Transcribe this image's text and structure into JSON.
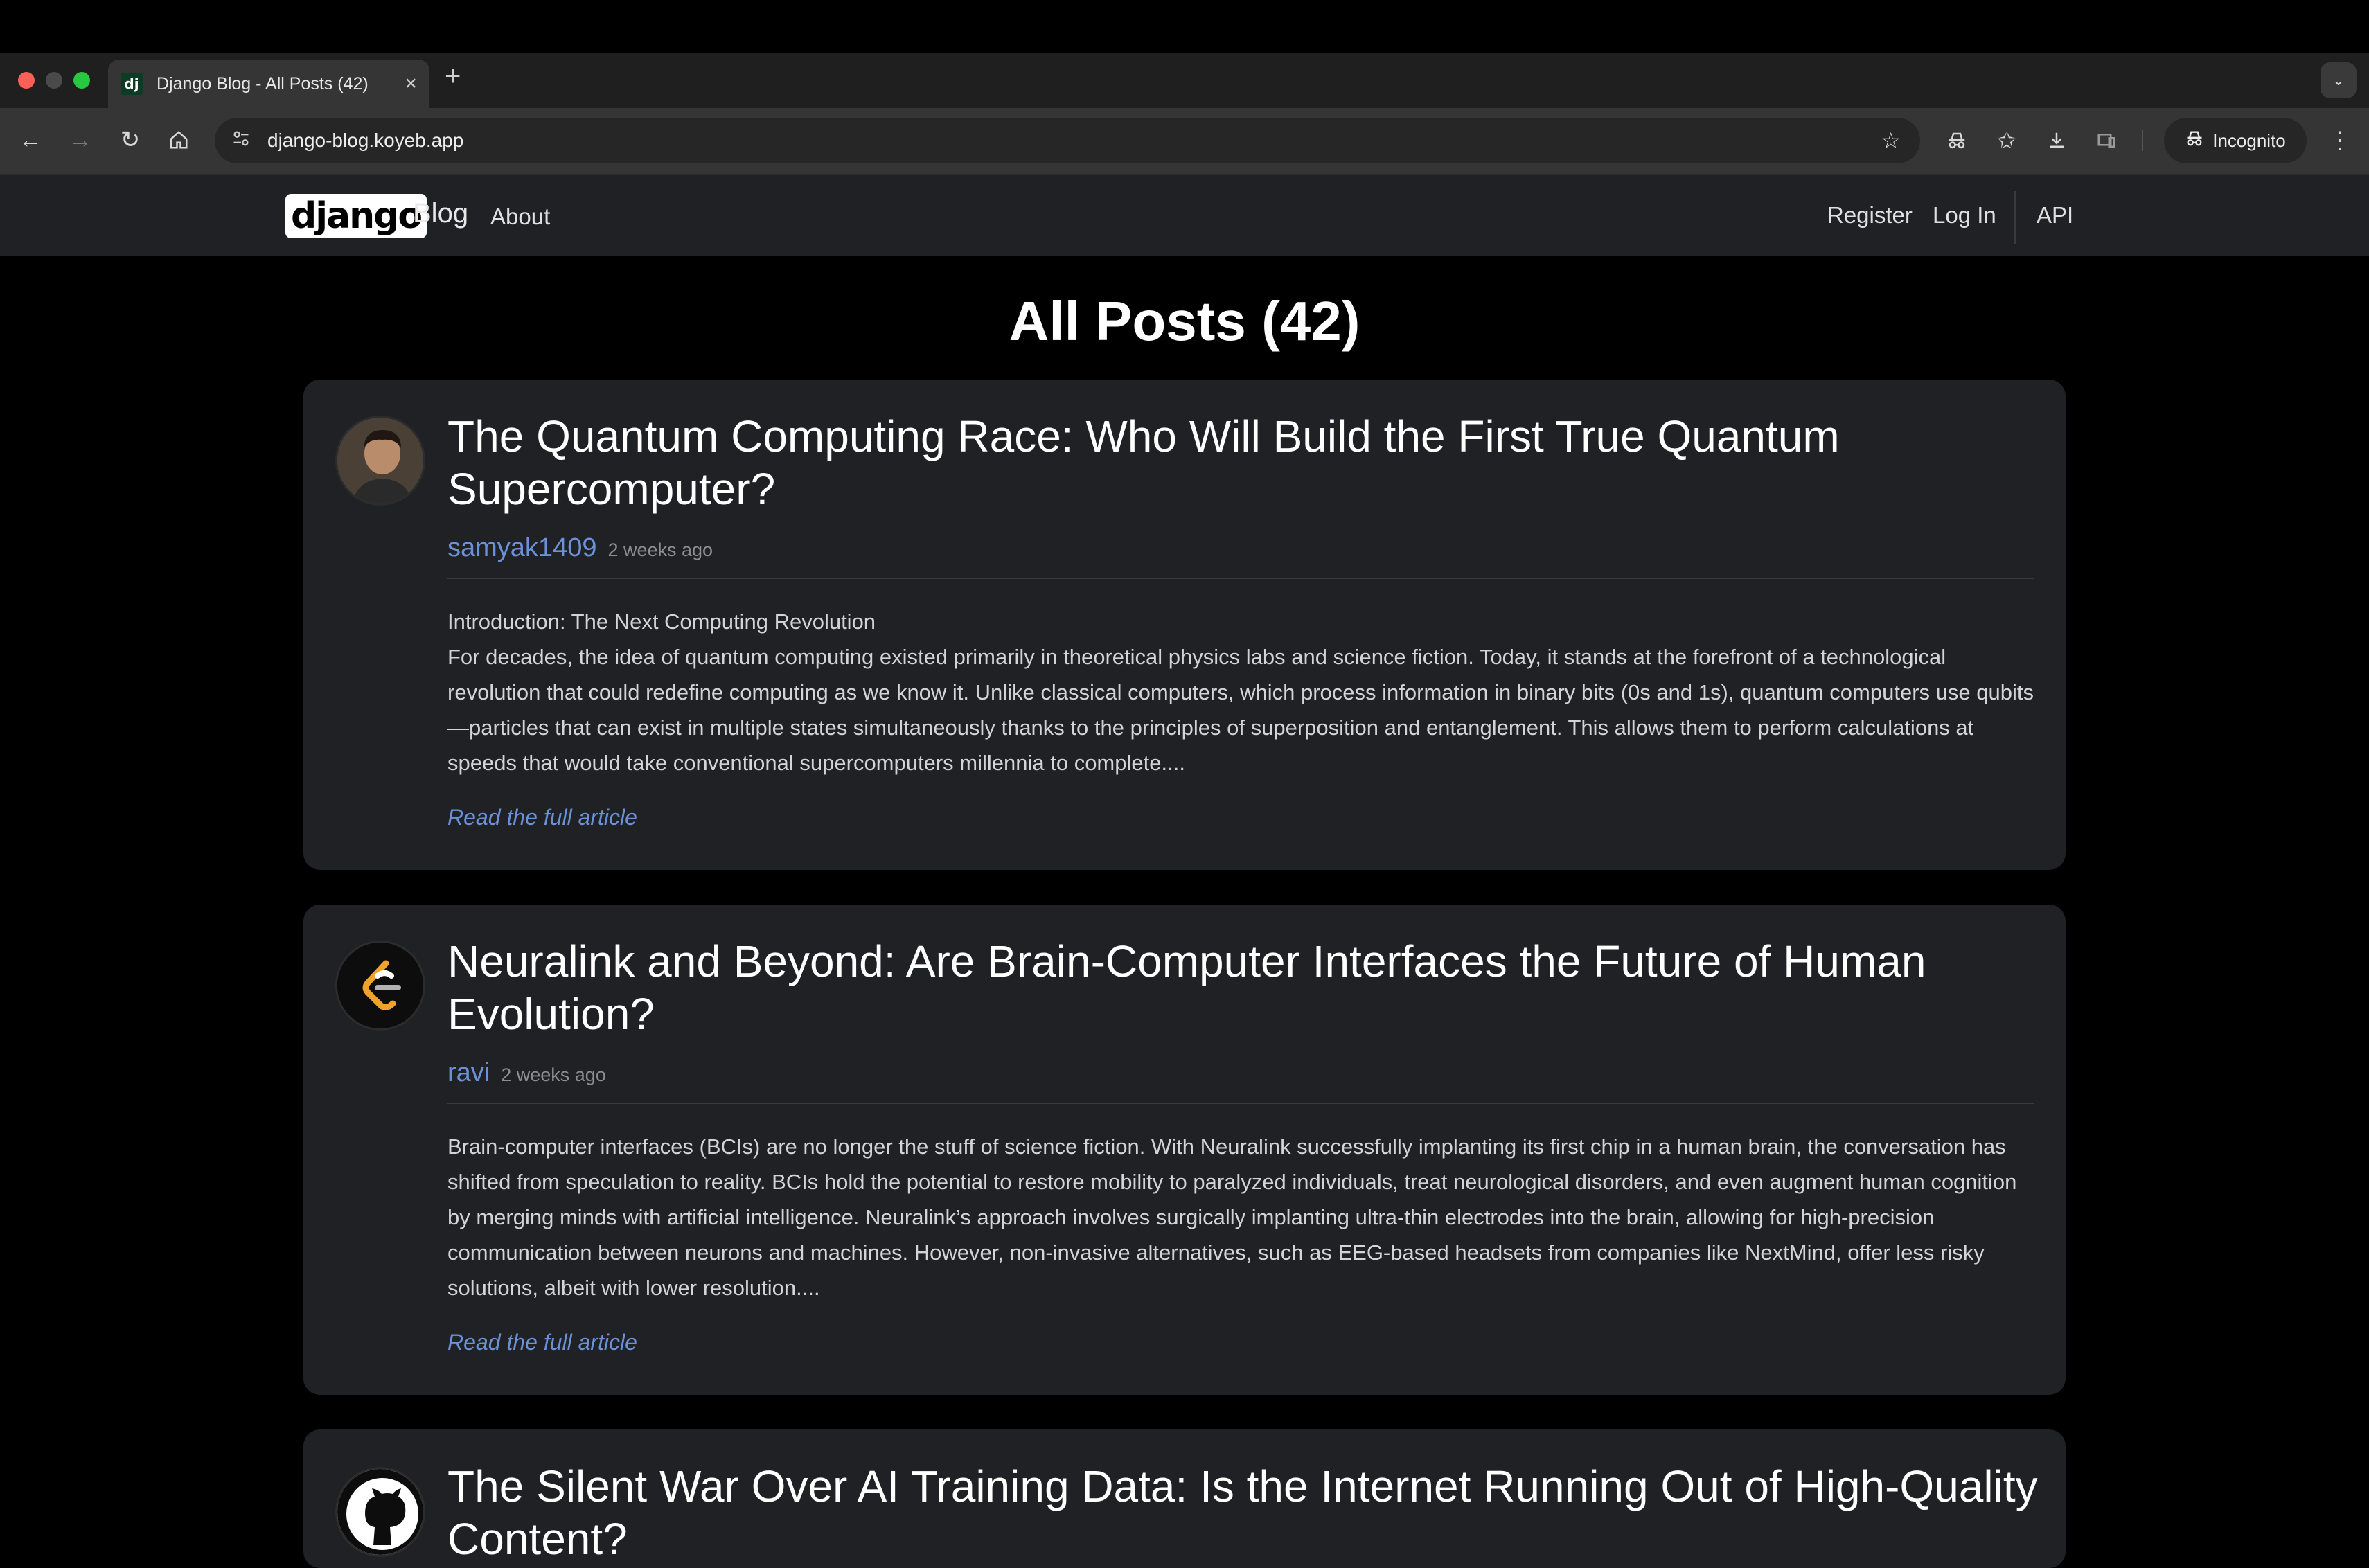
{
  "browser": {
    "tab_title": "Django Blog - All Posts (42)",
    "favicon_text": "dj",
    "new_tab": "+",
    "url": "django-blog.koyeb.app",
    "incognito_label": "Incognito"
  },
  "site": {
    "logo_text": "django",
    "brand": "Blog",
    "nav": {
      "about": "About",
      "register": "Register",
      "login": "Log In",
      "api": "API"
    }
  },
  "page": {
    "title": "All Posts (42)"
  },
  "posts": [
    {
      "title": "The Quantum Computing Race: Who Will Build the First True Quantum Supercomputer?",
      "author": "samyak1409",
      "date": "2 weeks ago",
      "excerpt": "Introduction: The Next Computing Revolution\nFor decades, the idea of quantum computing existed primarily in theoretical physics labs and science fiction. Today, it stands at the forefront of a technological revolution that could redefine computing as we know it. Unlike classical computers, which process information in binary bits (0s and 1s), quantum computers use qubits—particles that can exist in multiple states simultaneously thanks to the principles of superposition and entanglement. This allows them to perform calculations at speeds that would take conventional supercomputers millennia to complete....",
      "read_more": "Read the full article"
    },
    {
      "title": "Neuralink and Beyond: Are Brain-Computer Interfaces the Future of Human Evolution?",
      "author": "ravi",
      "date": "2 weeks ago",
      "excerpt": "Brain-computer interfaces (BCIs) are no longer the stuff of science fiction. With Neuralink successfully implanting its first chip in a human brain, the conversation has shifted from speculation to reality. BCIs hold the potential to restore mobility to paralyzed individuals, treat neurological disorders, and even augment human cognition by merging minds with artificial intelligence. Neuralink’s approach involves surgically implanting ultra-thin electrodes into the brain, allowing for high-precision communication between neurons and machines. However, non-invasive alternatives, such as EEG-based headsets from companies like NextMind, offer less risky solutions, albeit with lower resolution....",
      "read_more": "Read the full article"
    },
    {
      "title": "The Silent War Over AI Training Data: Is the Internet Running Out of High-Quality Content?"
    }
  ]
}
